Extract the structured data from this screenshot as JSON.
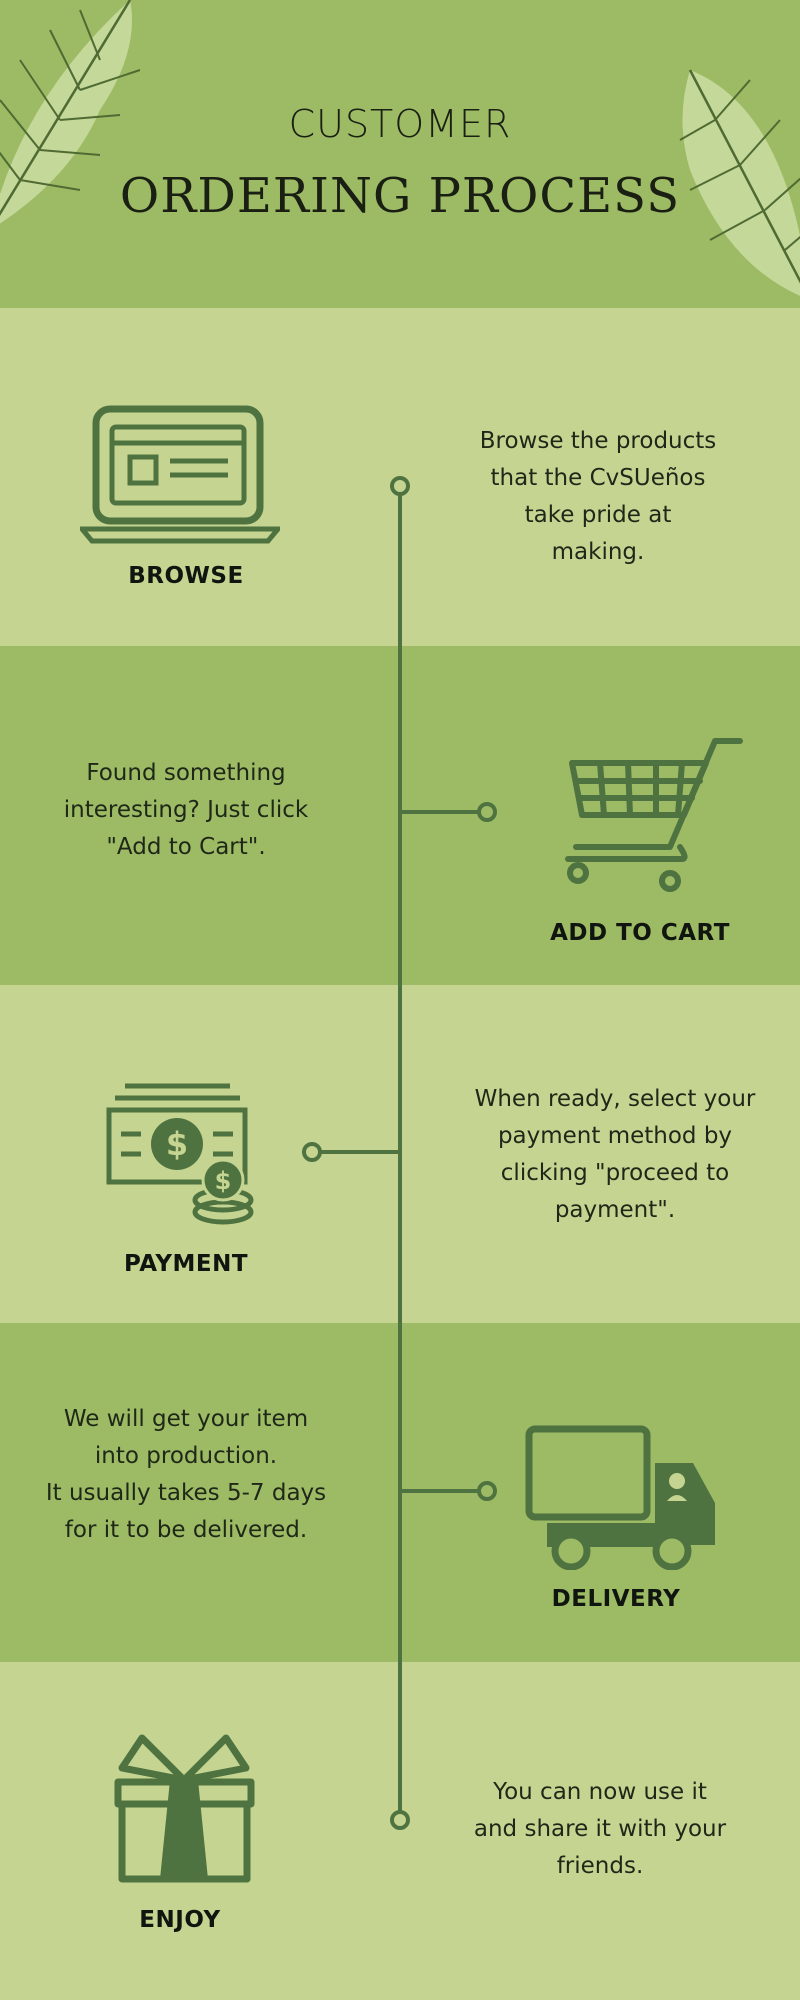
{
  "header": {
    "title_line1": "CUSTOMER",
    "title_line2": "ORDERING PROCESS"
  },
  "colors": {
    "dark_green": "#9dbb64",
    "light_green": "#c5d591",
    "accent": "#4f7340"
  },
  "steps": [
    {
      "label": "BROWSE",
      "icon": "laptop-icon",
      "description": "Browse the products\nthat the CvSUeños\ntake pride at\nmaking."
    },
    {
      "label": "ADD TO CART",
      "icon": "shopping-cart-icon",
      "description": "Found something\ninteresting? Just click\n\"Add to Cart\"."
    },
    {
      "label": "PAYMENT",
      "icon": "money-icon",
      "description": "When ready, select your\npayment method by\nclicking \"proceed to\npayment\"."
    },
    {
      "label": "DELIVERY",
      "icon": "truck-icon",
      "description": "We will get your item\ninto production.\nIt usually takes 5-7 days\nfor it to be delivered."
    },
    {
      "label": "ENJOY",
      "icon": "gift-icon",
      "description": "You can now use it\nand share it with your\nfriends."
    }
  ]
}
